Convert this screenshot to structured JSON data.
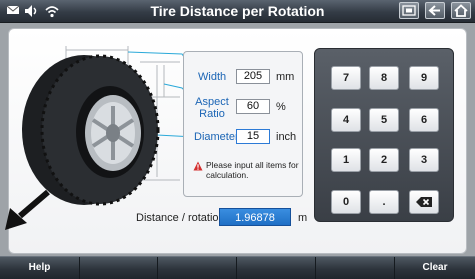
{
  "header": {
    "title": "Tire Distance per Rotation"
  },
  "status_icons": [
    "mail-icon",
    "volume-icon",
    "wifi-icon"
  ],
  "toolbar_icons": [
    "screenshot-icon",
    "back-icon",
    "home-icon"
  ],
  "form": {
    "width": {
      "label": "Width",
      "value": "205",
      "unit": "mm"
    },
    "aspect_ratio": {
      "label_line1": "Aspect",
      "label_line2": "Ratio",
      "value": "60",
      "unit": "%"
    },
    "diameter": {
      "label": "Diameter",
      "value": "15",
      "unit": "inch"
    },
    "warning": "Please input all items for calculation."
  },
  "result": {
    "label": "Distance / rotation",
    "value": "1.96878",
    "unit": "m"
  },
  "keypad": {
    "keys": [
      "7",
      "8",
      "9",
      "4",
      "5",
      "6",
      "1",
      "2",
      "3",
      "0",
      "."
    ],
    "backspace_icon": "backspace-icon"
  },
  "footer": {
    "help_label": "Help",
    "clear_label": "Clear"
  },
  "colors": {
    "accent": "#1b65b5",
    "result_bg": "#2a7fd6",
    "warning": "#d32f2f"
  }
}
